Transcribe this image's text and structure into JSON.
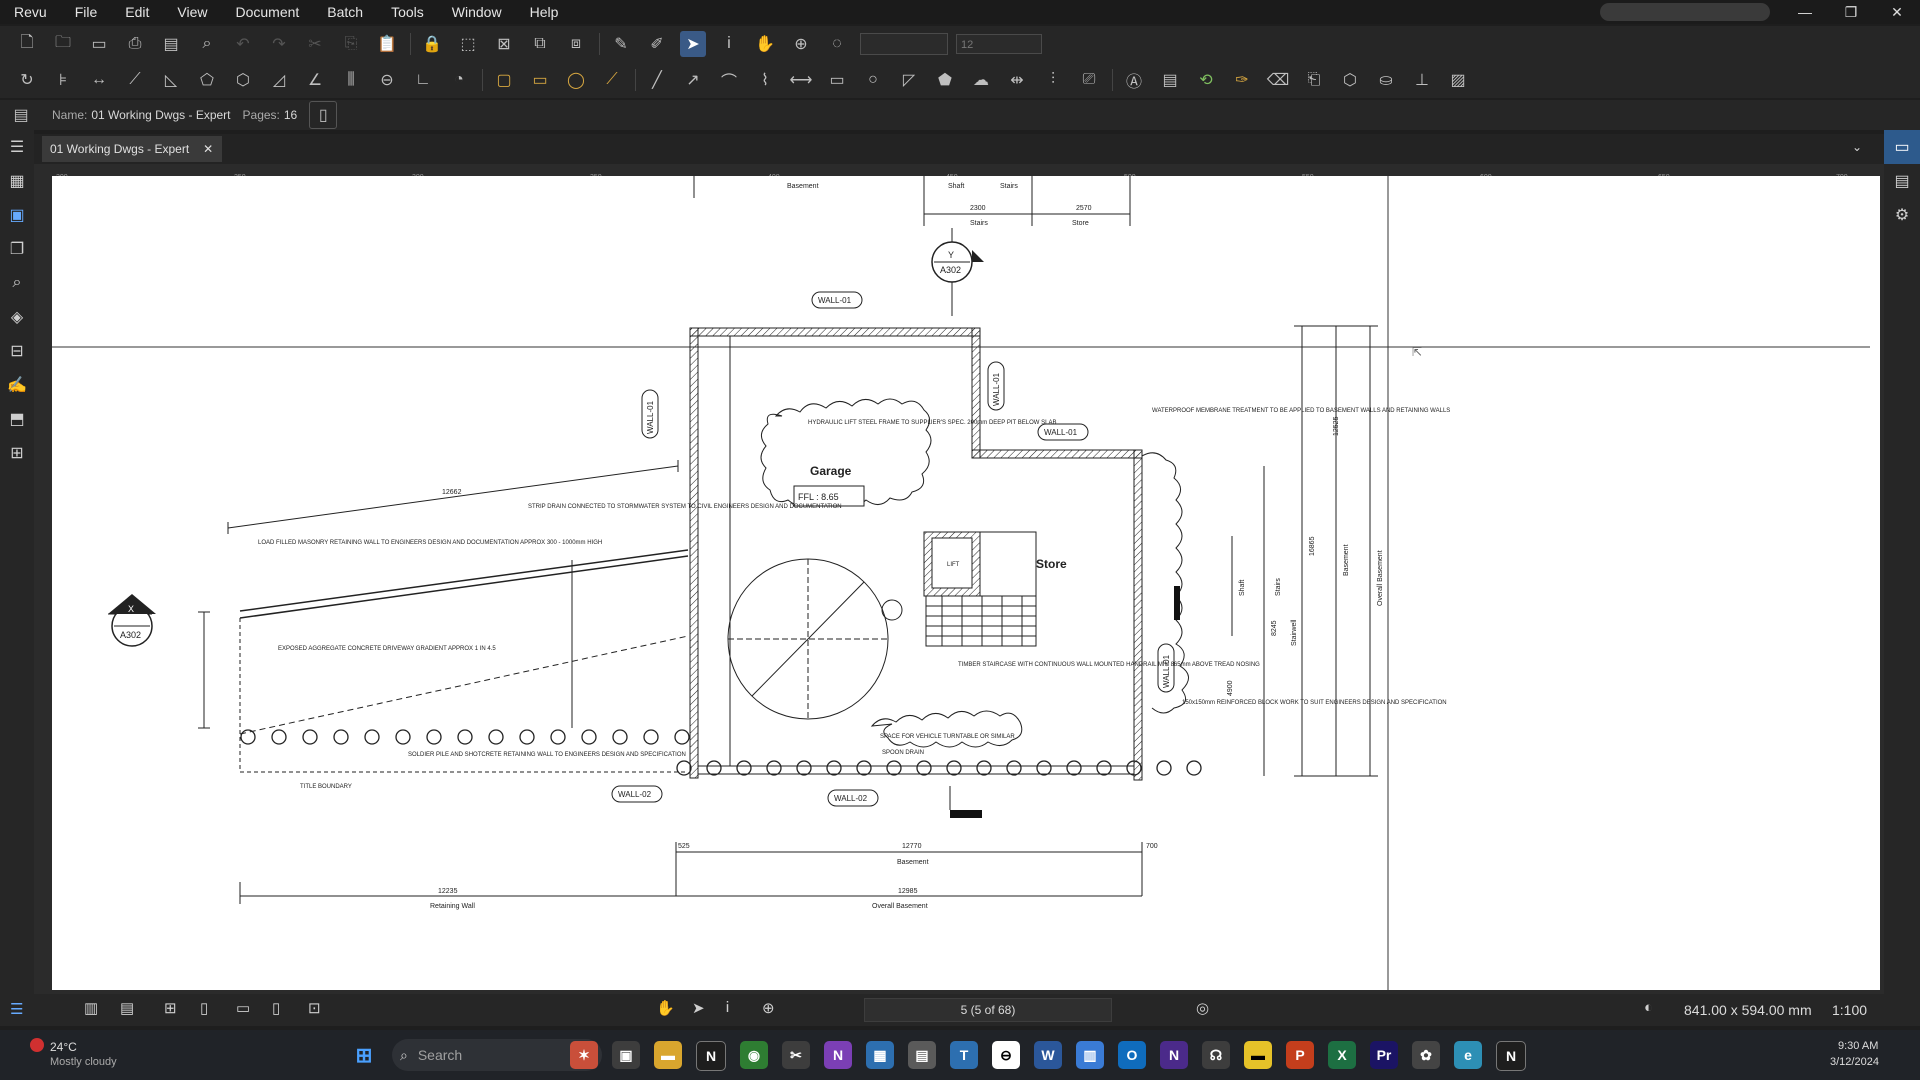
{
  "menu": [
    "Revu",
    "File",
    "Edit",
    "View",
    "Document",
    "Batch",
    "Tools",
    "Window",
    "Help"
  ],
  "window_controls": {
    "minimize": "—",
    "restore": "❐",
    "close": "✕"
  },
  "toolbar_combo": {
    "font_size": "12"
  },
  "doc": {
    "name_label": "Name:",
    "name_value": "01 Working Dwgs - Expert",
    "pages_label": "Pages:",
    "pages_value": "16"
  },
  "tab": {
    "label": "01 Working Dwgs - Expert",
    "close": "✕"
  },
  "ruler_ticks": [
    "200",
    "250",
    "300",
    "350",
    "400",
    "450",
    "500",
    "550",
    "600",
    "650",
    "700",
    "750",
    "800"
  ],
  "drawing": {
    "top_labels": [
      "Basement",
      "Shaft",
      "Stairs",
      "Stairs",
      "Store"
    ],
    "top_dims": [
      "2300",
      "2570"
    ],
    "section_y": {
      "letter": "Y",
      "ref": "A302"
    },
    "section_x": {
      "letter": "X",
      "ref": "A302"
    },
    "wall_tags": [
      "WALL-01",
      "WALL-01",
      "WALL-01",
      "WALL-01",
      "WALL-01",
      "WALL-02",
      "WALL-02"
    ],
    "room_garage": "Garage",
    "ffl": "FFL : 8.65",
    "room_store": "Store",
    "lift": "LIFT",
    "dim_ramp": "12662",
    "bottom_dims": {
      "basement_top": "12770",
      "basement_label": "Basement",
      "retaining_wall": "12235",
      "retaining_label": "Retaining Wall",
      "overall": "12985",
      "overall_label": "Overall Basement",
      "left_small": "525",
      "right_small": "700"
    },
    "right_labels": [
      "Shaft",
      "Stairs",
      "Stairwell",
      "Basement",
      "Overall Basement"
    ],
    "right_dims": [
      "16865",
      "12525",
      "8245",
      "4900"
    ],
    "notes": [
      "LOAD FILLED MASONRY RETAINING WALL TO ENGINEERS DESIGN AND DOCUMENTATION APPROX 300 - 1000mm HIGH",
      "STRIP DRAIN CONNECTED TO STORMWATER SYSTEM TO CIVIL ENGINEERS DESIGN AND DOCUMENTATION",
      "HYDRAULIC LIFT STEEL FRAME TO SUPPLIER'S SPEC. 200mm DEEP PIT BELOW SLAB",
      "WATERPROOF MEMBRANE TREATMENT TO BE APPLIED TO BASEMENT WALLS AND RETAINING WALLS",
      "EXPOSED AGGREGATE CONCRETE DRIVEWAY GRADIENT APPROX 1 IN 4.5",
      "TIMBER STAIRCASE WITH CONTINUOUS WALL MOUNTED HANDRAIL MIN 865mm ABOVE TREAD NOSING",
      "SOLDIER PILE AND SHOTCRETE RETAINING WALL TO ENGINEERS DESIGN AND SPECIFICATION",
      "SPACE FOR VEHICLE TURNTABLE OR SIMILAR",
      "150x150mm REINFORCED BLOCK WORK TO SUIT ENGINEERS DESIGN AND SPECIFICATION",
      "TITLE BOUNDARY",
      "SPOON DRAIN"
    ]
  },
  "status": {
    "page": "5 (5 of 68)",
    "size": "841.00 x 594.00 mm",
    "scale": "1:100"
  },
  "taskbar": {
    "weather_temp": "24°C",
    "weather_desc": "Mostly cloudy",
    "search": "Search",
    "time": "9:30 AM",
    "date": "3/12/2024"
  },
  "colors": {
    "accent": "#3a5a86",
    "sheet": "#ffffff",
    "chrome": "#262626"
  }
}
